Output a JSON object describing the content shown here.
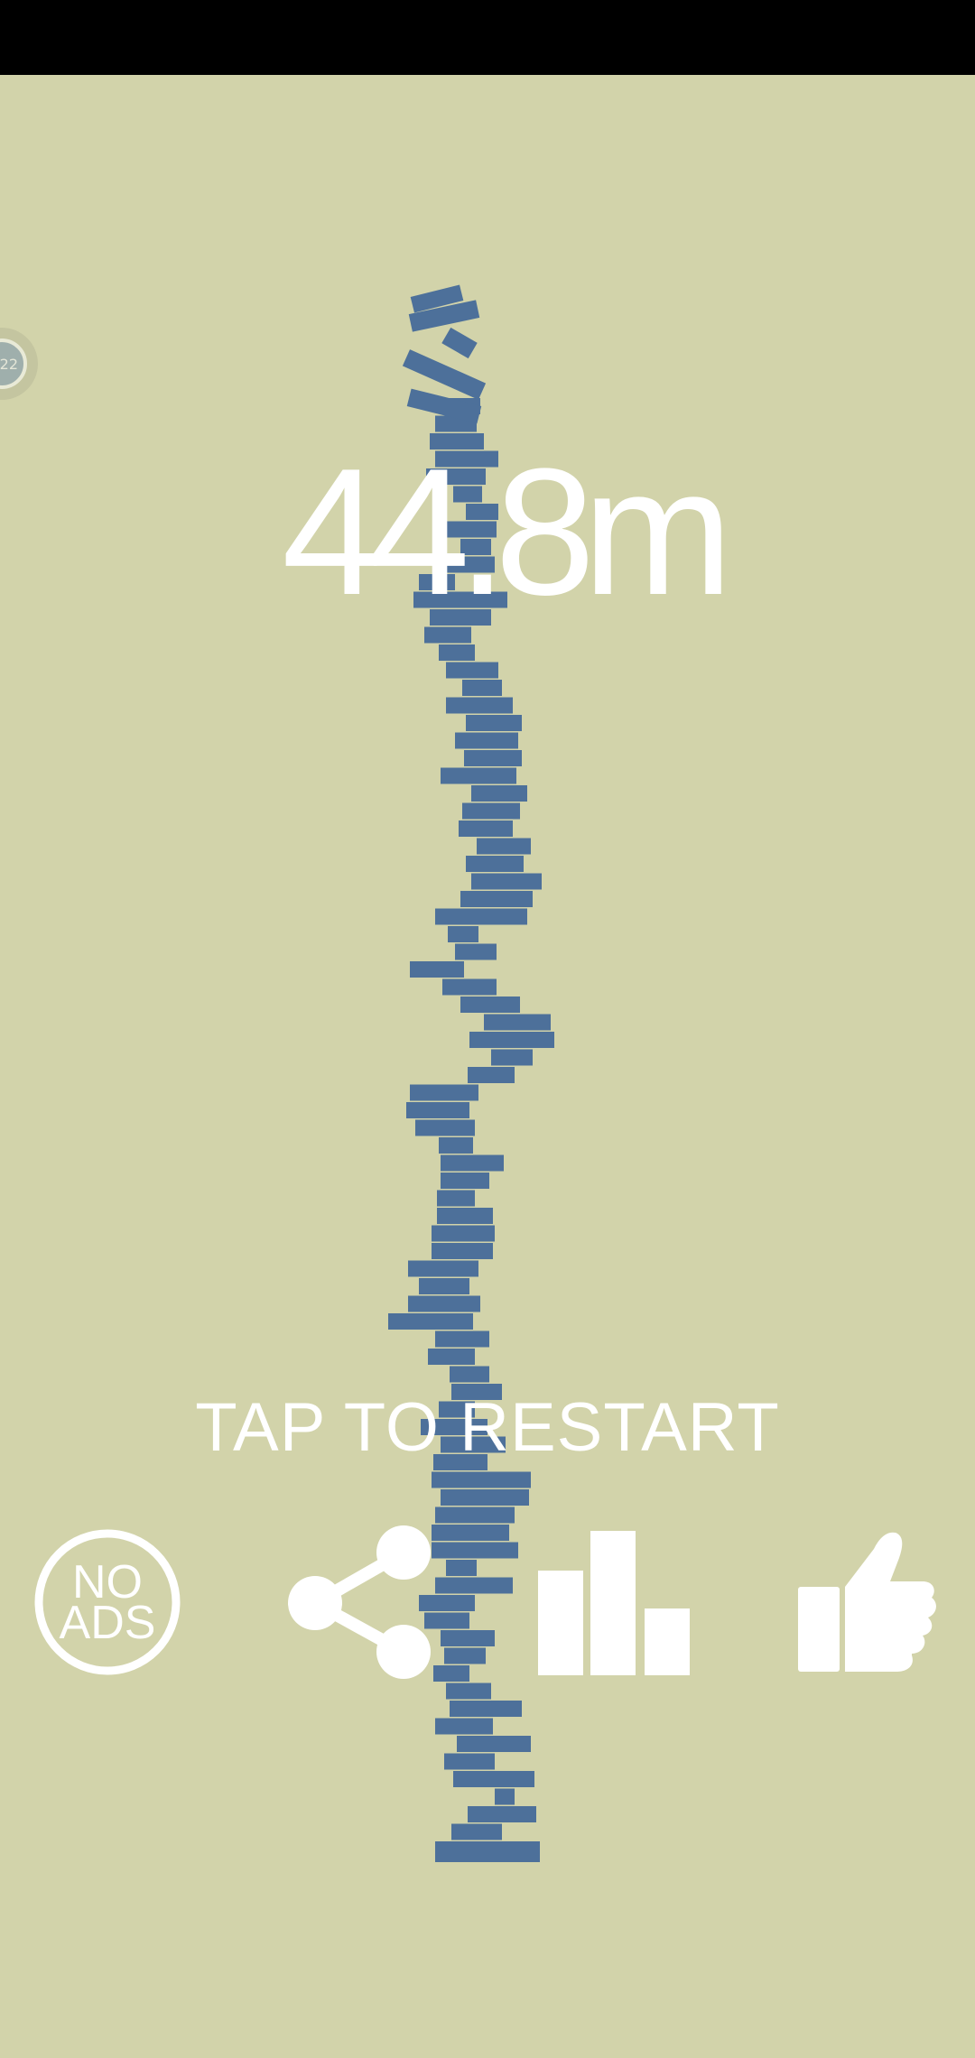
{
  "game": {
    "score": "44.8m",
    "restart_prompt": "TAP TO RESTART",
    "level_badge": "22"
  },
  "buttons": {
    "no_ads_line1": "NO",
    "no_ads_line2": "ADS"
  },
  "colors": {
    "background": "#D2D3AA",
    "block": "#4D709A",
    "text": "#FFFFFF",
    "status_bar": "#000000"
  },
  "icons": [
    "no-ads-icon",
    "share-icon",
    "leaderboard-icon",
    "thumbs-up-icon"
  ]
}
